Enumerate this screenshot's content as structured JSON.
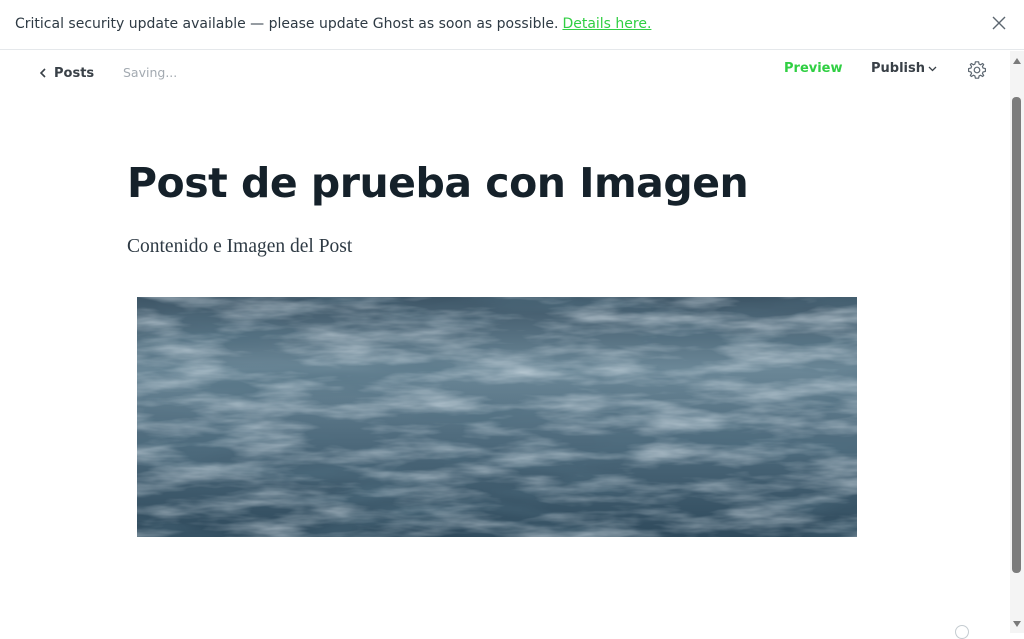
{
  "banner": {
    "message": "Critical security update available — please update Ghost as soon as possible.",
    "link_text": "Details here.",
    "close_icon": "close-icon"
  },
  "header": {
    "back_label": "Posts",
    "back_icon": "chevron-left-icon",
    "status": "Saving...",
    "preview_label": "Preview",
    "publish_label": "Publish",
    "publish_icon": "chevron-down-icon",
    "settings_icon": "gear-icon"
  },
  "post": {
    "title": "Post de prueba con Imagen",
    "body": "Contenido e Imagen del Post",
    "image": "water-surface-image"
  },
  "colors": {
    "accent": "#30cf43",
    "text": "#15212a",
    "muted": "#a3aab1"
  }
}
